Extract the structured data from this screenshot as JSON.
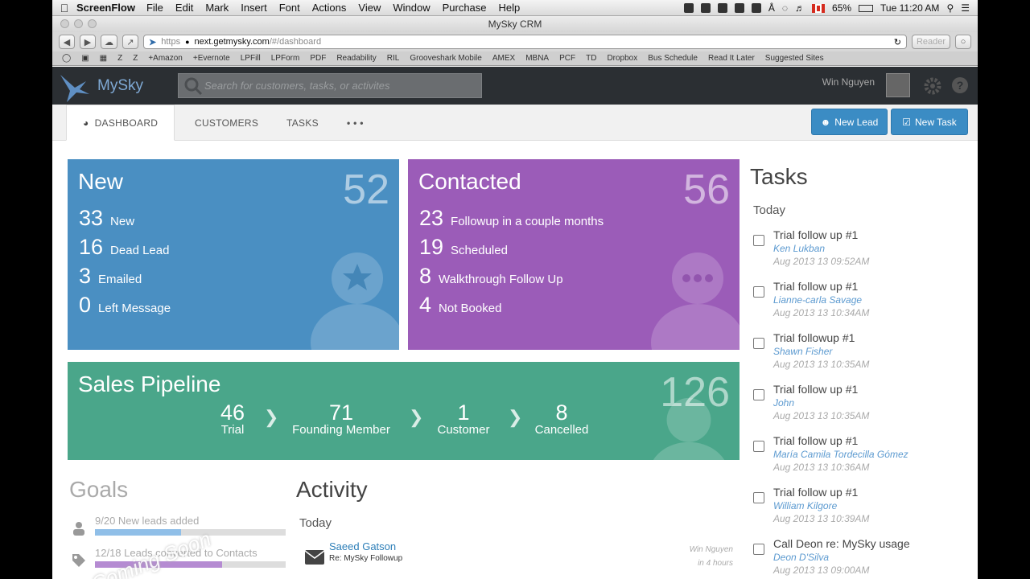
{
  "menubar": {
    "app": "ScreenFlow",
    "items": [
      "File",
      "Edit",
      "Mark",
      "Insert",
      "Font",
      "Actions",
      "View",
      "Window",
      "Purchase",
      "Help"
    ],
    "battery": "65%",
    "clock": "Tue 11:20 AM"
  },
  "window": {
    "title": "MySky CRM"
  },
  "browser": {
    "url_scheme": "https",
    "url_host": "next.getmysky.com",
    "url_path": "/#/dashboard",
    "reader": "Reader",
    "bookmarks": [
      "Z",
      "Z",
      "+Amazon",
      "+Evernote",
      "LPFill",
      "LPForm",
      "PDF",
      "Readability",
      "RIL",
      "Grooveshark Mobile",
      "AMEX",
      "MBNA",
      "PCF",
      "TD",
      "Dropbox",
      "Bus Schedule",
      "Read It Later",
      "Suggested Sites"
    ]
  },
  "header": {
    "brand": "MySky",
    "search_placeholder": "Search for customers, tasks, or activites",
    "user": "Win Nguyen"
  },
  "nav": {
    "tabs": [
      {
        "label": "DASHBOARD"
      },
      {
        "label": "CUSTOMERS"
      },
      {
        "label": "TASKS"
      },
      {
        "label": "• • •"
      }
    ],
    "new_lead": "New Lead",
    "new_task": "New Task"
  },
  "cards": {
    "new": {
      "title": "New",
      "total": "52",
      "color": "#4a8fc2",
      "rows": [
        {
          "n": "33",
          "label": "New"
        },
        {
          "n": "16",
          "label": "Dead Lead"
        },
        {
          "n": "3",
          "label": "Emailed"
        },
        {
          "n": "0",
          "label": "Left Message"
        }
      ]
    },
    "contacted": {
      "title": "Contacted",
      "total": "56",
      "color": "#9b5cb8",
      "rows": [
        {
          "n": "23",
          "label": "Followup in a couple months"
        },
        {
          "n": "19",
          "label": "Scheduled"
        },
        {
          "n": "8",
          "label": "Walkthrough Follow Up"
        },
        {
          "n": "4",
          "label": "Not Booked"
        }
      ]
    },
    "pipeline": {
      "title": "Sales Pipeline",
      "total": "126",
      "color": "#4aa68a",
      "stages": [
        {
          "n": "46",
          "label": "Trial"
        },
        {
          "n": "71",
          "label": "Founding Member"
        },
        {
          "n": "1",
          "label": "Customer"
        },
        {
          "n": "8",
          "label": "Cancelled"
        }
      ]
    }
  },
  "goals": {
    "title": "Goals",
    "items": [
      {
        "text": "9/20 New leads added",
        "progress": 0.45,
        "color": "#90bfe8"
      },
      {
        "text": "12/18 Leads converted to Contacts",
        "progress": 0.667,
        "color": "#b58bd2"
      }
    ],
    "overlay": "Coming Soon"
  },
  "activity": {
    "title": "Activity",
    "today": "Today",
    "items": [
      {
        "who": "Saeed Gatson",
        "subject": "Re: MySky Followup",
        "user": "Win Nguyen",
        "when": "in 4 hours"
      }
    ]
  },
  "tasks": {
    "title": "Tasks",
    "today": "Today",
    "items": [
      {
        "title": "Trial follow up #1",
        "who": "Ken Lukban",
        "when": "Aug 2013 13 09:52AM"
      },
      {
        "title": "Trial follow up #1",
        "who": "Lianne-carla Savage",
        "when": "Aug 2013 13 10:34AM"
      },
      {
        "title": "Trial followup #1",
        "who": "Shawn Fisher",
        "when": "Aug 2013 13 10:35AM"
      },
      {
        "title": "Trial follow up #1",
        "who": "John",
        "when": "Aug 2013 13 10:35AM"
      },
      {
        "title": "Trial follow up #1",
        "who": "María Camila Tordecilla Gómez",
        "when": "Aug 2013 13 10:36AM"
      },
      {
        "title": "Trial follow up #1",
        "who": "William Kilgore",
        "when": "Aug 2013 13 10:39AM"
      },
      {
        "title": "Call Deon re: MySky usage",
        "who": "Deon D'Silva",
        "when": "Aug 2013 13 09:00AM"
      }
    ]
  }
}
